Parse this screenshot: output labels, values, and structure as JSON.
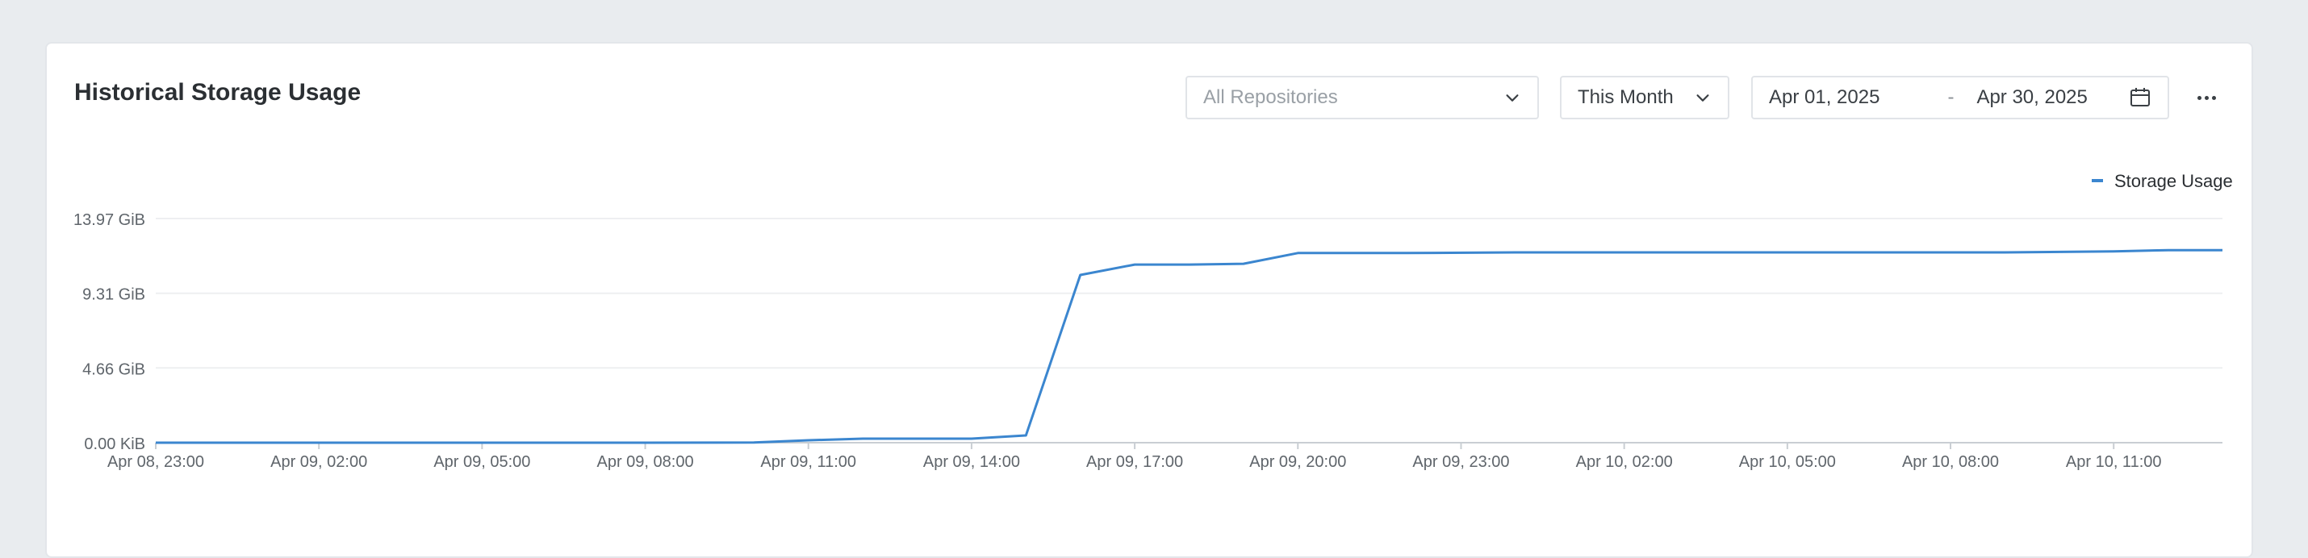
{
  "panel": {
    "title": "Historical Storage Usage",
    "repo_select": "All Repositories",
    "range_select": "This Month",
    "date_start": "Apr 01, 2025",
    "date_sep": "-",
    "date_end": "Apr 30, 2025",
    "icons": [
      "chevron-down-icon",
      "calendar-icon",
      "more-icon"
    ]
  },
  "colors": {
    "series": "#3b86cf",
    "grid": "#eeeff1",
    "axis": "#c9ced3",
    "tick_text": "#5f656b"
  },
  "chart_data": {
    "type": "line",
    "title": "",
    "xlabel": "",
    "ylabel": "",
    "legend": {
      "position": "top-right",
      "entries": [
        "Storage Usage"
      ]
    },
    "grid": true,
    "ylim": [
      0,
      13.97
    ],
    "y_ticks": [
      {
        "value": 0,
        "label": "0.00 KiB"
      },
      {
        "value": 4.66,
        "label": "4.66 GiB"
      },
      {
        "value": 9.31,
        "label": "9.31 GiB"
      },
      {
        "value": 13.97,
        "label": "13.97 GiB"
      }
    ],
    "x_ticks": [
      "Apr 08, 23:00",
      "Apr 09, 02:00",
      "Apr 09, 05:00",
      "Apr 09, 08:00",
      "Apr 09, 11:00",
      "Apr 09, 14:00",
      "Apr 09, 17:00",
      "Apr 09, 20:00",
      "Apr 09, 23:00",
      "Apr 10, 02:00",
      "Apr 10, 05:00",
      "Apr 10, 08:00",
      "Apr 10, 11:00"
    ],
    "xlim": [
      "Apr 08, 23:00",
      "Apr 10, 13:00"
    ],
    "series": [
      {
        "name": "Storage Usage",
        "points": [
          [
            "Apr 08, 23:00",
            0
          ],
          [
            "Apr 09, 02:00",
            0
          ],
          [
            "Apr 09, 05:00",
            0
          ],
          [
            "Apr 09, 08:00",
            0
          ],
          [
            "Apr 09, 10:00",
            0.01
          ],
          [
            "Apr 09, 11:00",
            0.15
          ],
          [
            "Apr 09, 12:00",
            0.25
          ],
          [
            "Apr 09, 14:00",
            0.25
          ],
          [
            "Apr 09, 15:00",
            0.45
          ],
          [
            "Apr 09, 16:00",
            10.45
          ],
          [
            "Apr 09, 17:00",
            11.1
          ],
          [
            "Apr 09, 18:00",
            11.1
          ],
          [
            "Apr 09, 19:00",
            11.15
          ],
          [
            "Apr 09, 20:00",
            11.82
          ],
          [
            "Apr 09, 22:00",
            11.82
          ],
          [
            "Apr 10, 00:00",
            11.86
          ],
          [
            "Apr 10, 03:00",
            11.86
          ],
          [
            "Apr 10, 06:00",
            11.86
          ],
          [
            "Apr 10, 09:00",
            11.86
          ],
          [
            "Apr 10, 11:00",
            11.92
          ],
          [
            "Apr 10, 12:00",
            12.0
          ],
          [
            "Apr 10, 13:00",
            12.0
          ]
        ]
      }
    ]
  }
}
